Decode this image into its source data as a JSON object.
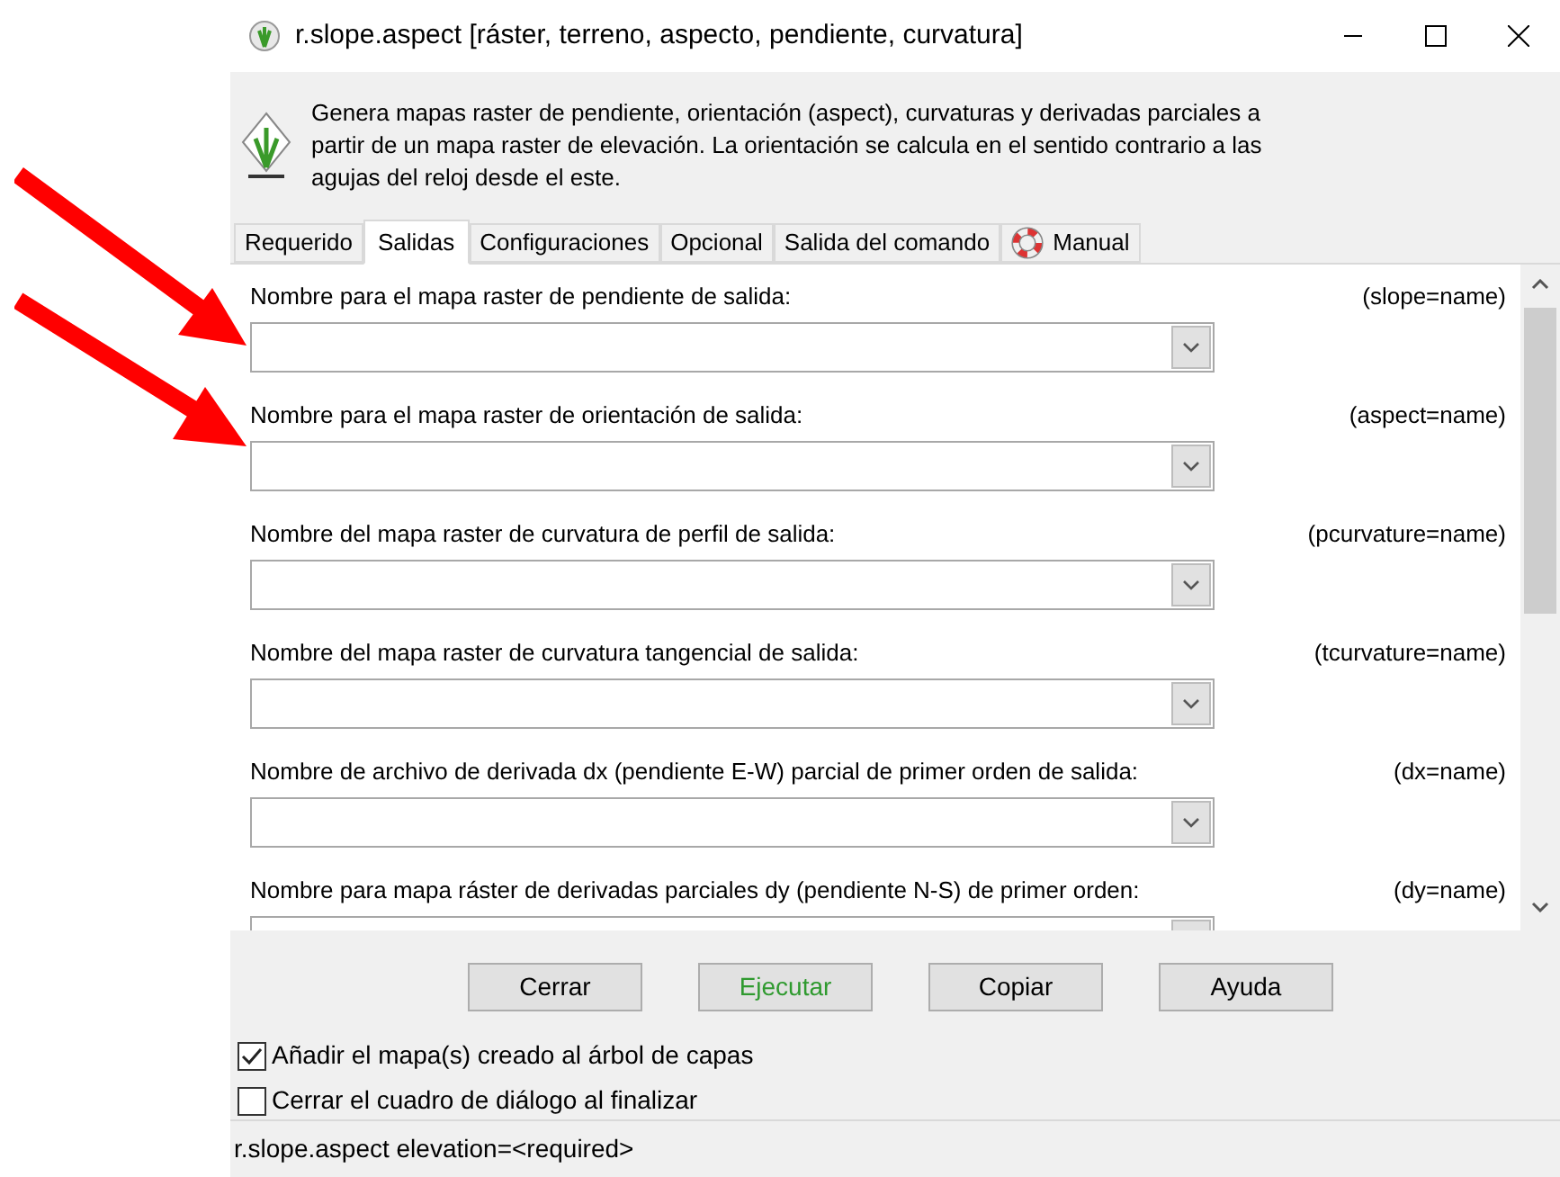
{
  "window": {
    "title": "r.slope.aspect [ráster, terreno, aspecto, pendiente, curvatura]"
  },
  "description": "Genera mapas raster de pendiente, orientación (aspect), curvaturas y derivadas parciales a partir de un mapa raster de elevación. La orientación se calcula en el sentido contrario a las agujas del reloj desde el este.",
  "tabs": [
    {
      "label": "Requerido",
      "selected": false,
      "kind": "plain"
    },
    {
      "label": "Salidas",
      "selected": true,
      "kind": "plain"
    },
    {
      "label": "Configuraciones",
      "selected": false,
      "kind": "plain"
    },
    {
      "label": "Opcional",
      "selected": false,
      "kind": "plain"
    },
    {
      "label": "Salida del comando",
      "selected": false,
      "kind": "plain"
    },
    {
      "label": "Manual",
      "selected": false,
      "kind": "help"
    }
  ],
  "fields": [
    {
      "label": "Nombre para el mapa raster de pendiente de salida:",
      "param": "(slope=name)"
    },
    {
      "label": "Nombre para el mapa raster de orientación de salida:",
      "param": "(aspect=name)"
    },
    {
      "label": "Nombre del mapa raster de curvatura de perfil de salida:",
      "param": "(pcurvature=name)"
    },
    {
      "label": "Nombre del mapa raster de curvatura tangencial de salida:",
      "param": "(tcurvature=name)"
    },
    {
      "label": "Nombre de archivo de derivada dx (pendiente E-W) parcial de primer  orden de salida:",
      "param": "(dx=name)"
    },
    {
      "label": "Nombre para mapa ráster de derivadas parciales dy (pendiente N-S) de  primer orden:",
      "param": "(dy=name)"
    }
  ],
  "buttons": [
    {
      "label": "Cerrar",
      "kind": "normal"
    },
    {
      "label": "Ejecutar",
      "kind": "run"
    },
    {
      "label": "Copiar",
      "kind": "normal"
    },
    {
      "label": "Ayuda",
      "kind": "normal"
    }
  ],
  "checkboxes": [
    {
      "label": "Añadir el mapa(s) creado al árbol de capas",
      "checked": true
    },
    {
      "label": "Cerrar el cuadro de diálogo al finalizar",
      "checked": false
    }
  ],
  "status_bar": "r.slope.aspect elevation=<required>"
}
